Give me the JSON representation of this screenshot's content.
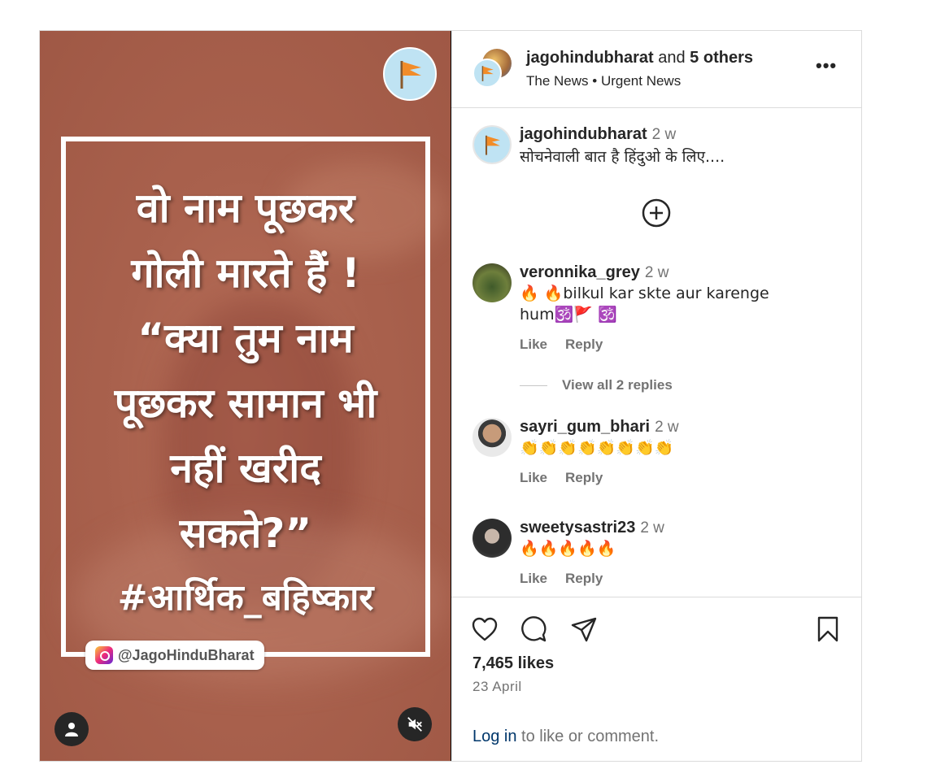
{
  "post": {
    "image_text": {
      "line1": "वो नाम पूछकर",
      "line2": "गोली मारते हैं !",
      "line3": "“क्या तुम नाम",
      "line4": "पूछकर सामान भी",
      "line5": "नहीं खरीद",
      "line6": "सकते?”",
      "hashtag": "#आर्थिक_बहिष्कार"
    },
    "watermark_handle": "@JagoHinduBharat"
  },
  "header": {
    "username": "jagohindubharat",
    "and_text": "and",
    "others": "5 others",
    "subtitle_a": "The News",
    "separator": "•",
    "subtitle_b": "Urgent News",
    "more_icon": "more-horizontal-icon"
  },
  "caption": {
    "username": "jagohindubharat",
    "time": "2 w",
    "text": "सोचनेवाली बात है हिंदुओ के लिए...."
  },
  "comments": [
    {
      "username": "veronnika_grey",
      "time": "2 w",
      "line1": "🔥 🔥bilkul kar skte aur karenge",
      "line2": "hum🕉️🚩 🕉️",
      "like": "Like",
      "reply": "Reply"
    },
    {
      "username": "sayri_gum_bhari",
      "time": "2 w",
      "line1": "👏👏👏👏👏👏👏👏",
      "like": "Like",
      "reply": "Reply"
    },
    {
      "username": "sweetysastri23",
      "time": "2 w",
      "line1": "🔥🔥🔥🔥🔥",
      "like": "Like",
      "reply": "Reply"
    }
  ],
  "view_replies": "View all 2 replies",
  "footer": {
    "likes": "7,465 likes",
    "date": "23 April",
    "login_link": "Log in",
    "login_rest": " to like or comment."
  },
  "colors": {
    "accent_link": "#00376b",
    "muted": "#737373",
    "border": "#dbdbdb",
    "flag": "#f28c28"
  }
}
